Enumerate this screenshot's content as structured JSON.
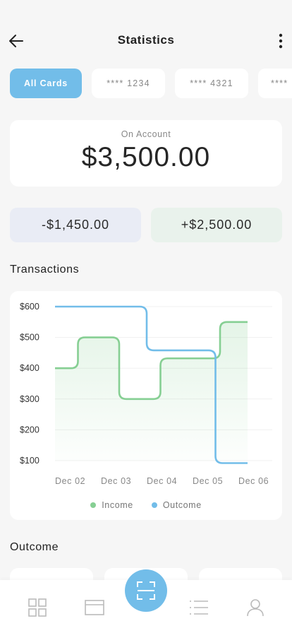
{
  "header": {
    "title": "Statistics",
    "back_icon": "arrow-left-icon",
    "more_icon": "more-vertical-icon"
  },
  "cards": [
    {
      "label": "All Cards",
      "active": true
    },
    {
      "label": "**** 1234",
      "active": false
    },
    {
      "label": "**** 4321",
      "active": false
    },
    {
      "label": "****",
      "active": false
    }
  ],
  "account": {
    "label": "On Account",
    "value": "$3,500.00"
  },
  "summary": {
    "outcome": "-$1,450.00",
    "income": "+$2,500.00"
  },
  "sections": {
    "transactions": "Transactions",
    "outcome": "Outcome"
  },
  "chart_data": {
    "type": "line",
    "x_ticks": [
      "Dec 02",
      "Dec 03",
      "Dec 04",
      "Dec 05",
      "Dec 06"
    ],
    "y_ticks": [
      "$600",
      "$500",
      "$400",
      "$300",
      "$200",
      "$100"
    ],
    "ylim": [
      100,
      600
    ],
    "series": [
      {
        "name": "Income",
        "color": "#86cf93",
        "steps": [
          {
            "x_from": "Dec 02",
            "x_to": "Dec 02.5",
            "value": 400
          },
          {
            "x_from": "Dec 02.5",
            "x_to": "Dec 03.4",
            "value": 500
          },
          {
            "x_from": "Dec 03.4",
            "x_to": "Dec 04.3",
            "value": 300
          },
          {
            "x_from": "Dec 04.3",
            "x_to": "Dec 05.6",
            "value": 432
          },
          {
            "x_from": "Dec 05.6",
            "x_to": "Dec 06.2",
            "value": 550
          }
        ]
      },
      {
        "name": "Outcome",
        "color": "#72bde9",
        "steps": [
          {
            "x_from": "Dec 02",
            "x_to": "Dec 04",
            "value": 600
          },
          {
            "x_from": "Dec 04",
            "x_to": "Dec 05.5",
            "value": 458
          },
          {
            "x_from": "Dec 05.5",
            "x_to": "Dec 06.2",
            "value": 92
          }
        ]
      }
    ]
  },
  "legend": {
    "income": "Income",
    "outcome": "Outcome",
    "income_color": "#86cf93",
    "outcome_color": "#72bde9"
  },
  "nav": {
    "items": [
      "grid-icon",
      "card-icon",
      "scan-icon",
      "list-icon",
      "user-icon"
    ]
  },
  "colors": {
    "accent": "#72bde9",
    "income": "#86cf93",
    "outcome": "#72bde9"
  }
}
